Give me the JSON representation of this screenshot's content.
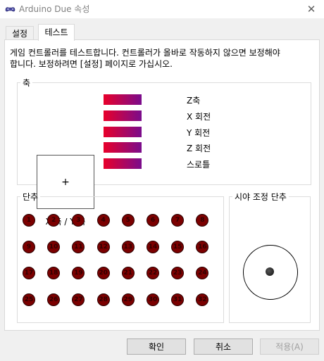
{
  "window": {
    "title": "Arduino Due 속성",
    "close_icon": "close-icon"
  },
  "tabs": [
    {
      "label": "설정",
      "selected": false
    },
    {
      "label": "테스트",
      "selected": true
    }
  ],
  "description": "게임 컨트롤러를 테스트합니다. 컨트롤러가 올바로 작동하지 않으면 보정해야\n합니다. 보정하려면 [설정] 페이지로 가십시오.",
  "axes": {
    "legend": "축",
    "xy_label": "X 축 / Y 축",
    "crosshair": "+",
    "bars": [
      {
        "label": "Z축"
      },
      {
        "label": "X 회전"
      },
      {
        "label": "Y 회전"
      },
      {
        "label": "Z 회전"
      },
      {
        "label": "스로틀"
      }
    ],
    "bar_colors": [
      "#e8002a",
      "#7a0c8c"
    ]
  },
  "buttons_group": {
    "legend": "단추",
    "buttons": [
      "1",
      "2",
      "3",
      "4",
      "5",
      "6",
      "7",
      "8",
      "9",
      "10",
      "11",
      "12",
      "13",
      "14",
      "15",
      "16",
      "17",
      "18",
      "19",
      "20",
      "21",
      "22",
      "23",
      "24",
      "25",
      "26",
      "27",
      "28",
      "29",
      "30",
      "31",
      "32"
    ],
    "color": "#7b0000"
  },
  "pov": {
    "legend": "시야 조정 단추"
  },
  "footer": {
    "ok": "확인",
    "cancel": "취소",
    "apply": "적용(A)"
  }
}
